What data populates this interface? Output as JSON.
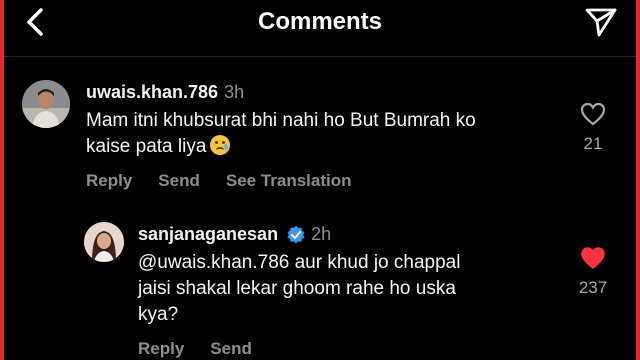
{
  "header": {
    "title": "Comments",
    "back_icon": "chevron-left-icon",
    "share_icon": "send-icon"
  },
  "comments": [
    {
      "username": "uwais.khan.786",
      "time": "3h",
      "line1": "Mam itni khubsurat bhi nahi ho But Bumrah ko",
      "line2": "kaise pata liya",
      "emoji": "crying-face-emoji",
      "likes": "21",
      "liked": false,
      "actions": {
        "reply": "Reply",
        "send": "Send",
        "translate": "See Translation"
      }
    },
    {
      "username": "sanjanaganesan",
      "verified": true,
      "time": "2h",
      "line1": "@uwais.khan.786 aur khud jo chappal",
      "line2": "jaisi shakal lekar ghoom rahe ho uska",
      "line3": "kya?",
      "likes": "237",
      "liked": true,
      "actions": {
        "reply": "Reply",
        "send": "Send"
      }
    }
  ],
  "colors": {
    "background": "#000000",
    "liked": "#ff3040",
    "muted": "#8e8e8e",
    "verified": "#3897f0",
    "frame": "#e3262f"
  }
}
